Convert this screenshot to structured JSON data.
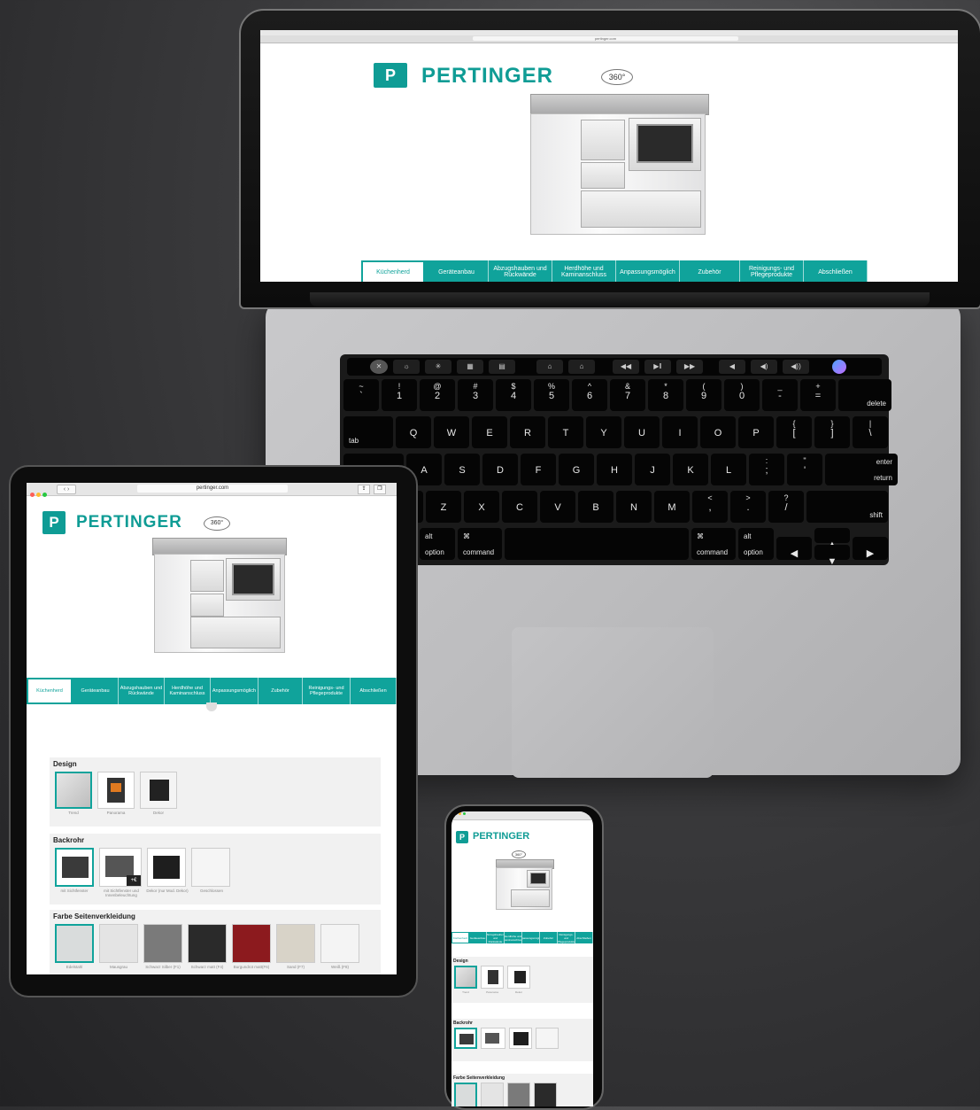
{
  "site": {
    "brand": "PERTINGER",
    "logo_letter": "P",
    "badge": "360°",
    "url": "pertinger.com",
    "accent": "#10a39b"
  },
  "nav": {
    "tabs": [
      "Küchenherd",
      "Geräteanbau",
      "Abzugshauben und Rückwände",
      "Herdhöhe und Kaminanschluss",
      "Anpassungsmöglich",
      "Zubehör",
      "Reinigungs- und Pflegeprodukte",
      "Abschließen"
    ],
    "active_index": 0
  },
  "sections": {
    "design": {
      "title": "Design",
      "options": [
        "Trend",
        "Panorama",
        "Dekor"
      ],
      "selected": 0
    },
    "backrohr": {
      "title": "Backrohr",
      "options": [
        "mit Sichtfenster",
        "mit Sichtfenster und Innenbeleuchtung",
        "Dekor (nur Mod. Dekor)",
        "Geschlossen"
      ],
      "price_badge": "+€",
      "selected": 0
    },
    "farbe": {
      "title": "Farbe Seitenverkleidung",
      "options": [
        "Edelstahl",
        "Mausgrau",
        "Schwarz Silber (F1)",
        "Schwarz matt (F4)",
        "Burgundrot matt(F6)",
        "Sand (F7)",
        "Weiß (F8)"
      ],
      "colors": [
        "#d9dcdc",
        "#e4e4e4",
        "#7a7a7a",
        "#2a2a2a",
        "#8c1a1e",
        "#d8d3c8",
        "#f4f4f4"
      ],
      "selected": 0
    }
  },
  "keyboard": {
    "num_row": [
      [
        "~",
        "`"
      ],
      [
        "!",
        "1"
      ],
      [
        "@",
        "2"
      ],
      [
        "#",
        "3"
      ],
      [
        "$",
        "4"
      ],
      [
        "%",
        "5"
      ],
      [
        "^",
        "6"
      ],
      [
        "&",
        "7"
      ],
      [
        "*",
        "8"
      ],
      [
        "(",
        "9"
      ],
      [
        ")",
        "0"
      ],
      [
        "_",
        "-"
      ],
      [
        "+",
        "="
      ]
    ],
    "delete": "delete",
    "tab": "tab",
    "qrow": [
      "Q",
      "W",
      "E",
      "R",
      "T",
      "Y",
      "U",
      "I",
      "O",
      "P"
    ],
    "qrow_brackets": [
      [
        "{",
        "["
      ],
      [
        "}",
        "]"
      ],
      [
        "|",
        "\\"
      ]
    ],
    "arow": [
      "A",
      "S",
      "D",
      "F",
      "G",
      "H",
      "J",
      "K",
      "L"
    ],
    "arow_punct": [
      [
        ":",
        ";"
      ],
      [
        "\"",
        "'"
      ]
    ],
    "enter": "enter",
    "return": "return",
    "zrow": [
      "Z",
      "X",
      "C",
      "V",
      "B",
      "N",
      "M"
    ],
    "zrow_punct": [
      [
        "<",
        ","
      ],
      [
        ">",
        "."
      ],
      [
        "?",
        "/"
      ]
    ],
    "shift": "shift",
    "alt": "alt",
    "option": "option",
    "cmd_symbol": "⌘",
    "command": "command",
    "arrows": [
      "◀",
      "▲",
      "▼",
      "▶"
    ]
  }
}
